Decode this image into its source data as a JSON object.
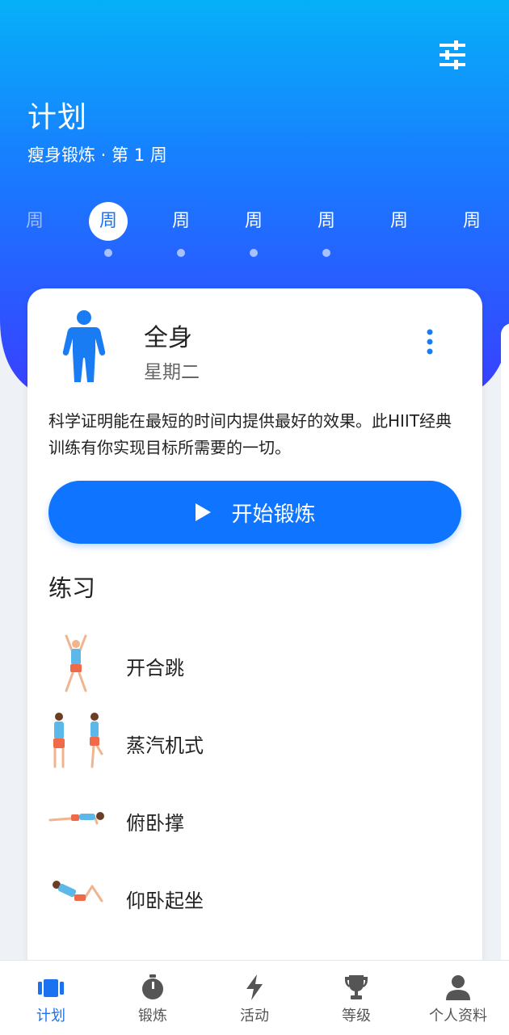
{
  "header": {
    "title": "计划",
    "subtitle": "瘦身锻炼 · 第 1 周",
    "weeks": [
      "周",
      "周",
      "周",
      "周",
      "周",
      "周",
      "周"
    ]
  },
  "workout": {
    "title": "全身",
    "day": "星期二",
    "description": "科学证明能在最短的时间内提供最好的效果。此HIIT经典训练有你实现目标所需要的一切。",
    "start_label": "开始锻炼"
  },
  "exercises": {
    "title": "练习",
    "items": [
      {
        "name": "开合跳"
      },
      {
        "name": "蒸汽机式"
      },
      {
        "name": "俯卧撑"
      },
      {
        "name": "仰卧起坐"
      }
    ]
  },
  "tabs": [
    {
      "label": "计划",
      "icon": "plan-icon",
      "active": true
    },
    {
      "label": "锻炼",
      "icon": "stopwatch-icon"
    },
    {
      "label": "活动",
      "icon": "lightning-icon"
    },
    {
      "label": "等级",
      "icon": "trophy-icon"
    },
    {
      "label": "个人资料",
      "icon": "person-icon"
    }
  ],
  "colors": {
    "accent": "#0f74ff",
    "header_top": "#06b0f8",
    "header_bottom": "#3a3dff"
  }
}
